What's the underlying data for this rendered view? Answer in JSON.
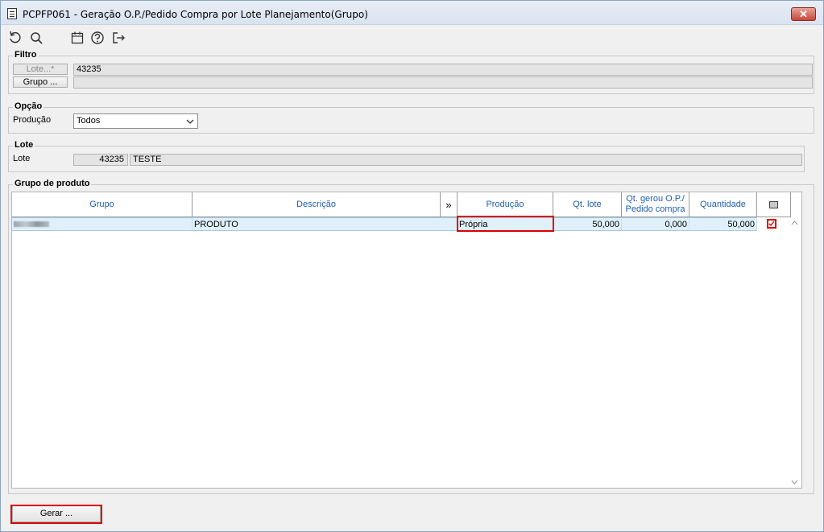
{
  "window": {
    "title": "PCPFP061 - Geração O.P./Pedido Compra por Lote Planejamento(Grupo)",
    "close_label": "✕"
  },
  "toolbar": {
    "icons": [
      "refresh-icon",
      "search-icon",
      "calendar-icon",
      "help-icon",
      "exit-icon"
    ]
  },
  "filtro": {
    "title": "Filtro",
    "lote_button": "Lote...*",
    "lote_value": "43235",
    "grupo_button": "Grupo ...",
    "grupo_value": ""
  },
  "opcao": {
    "title": "Opção",
    "producao_label": "Produção",
    "producao_value": "Todos"
  },
  "lote": {
    "title": "Lote",
    "label": "Lote",
    "number": "43235",
    "description": "TESTE"
  },
  "grupo_produto": {
    "title": "Grupo de produto",
    "columns": {
      "grupo": "Grupo",
      "descricao": "Descrição",
      "more": "»",
      "producao": "Produção",
      "qt_lote": "Qt. lote",
      "qt_gerou": "Qt. gerou O.P./ Pedido compra",
      "quantidade": "Quantidade"
    },
    "rows": [
      {
        "grupo": "",
        "descricao": "PRODUTO",
        "producao": "Própria",
        "qt_lote": "50,000",
        "qt_gerou": "0,000",
        "quantidade": "50,000",
        "checked": true
      }
    ]
  },
  "footer": {
    "gerar_button": "Gerar ..."
  },
  "colors": {
    "highlight": "#d90000",
    "header_text": "#1f5fb2",
    "selected_row": "#dff0fb"
  }
}
